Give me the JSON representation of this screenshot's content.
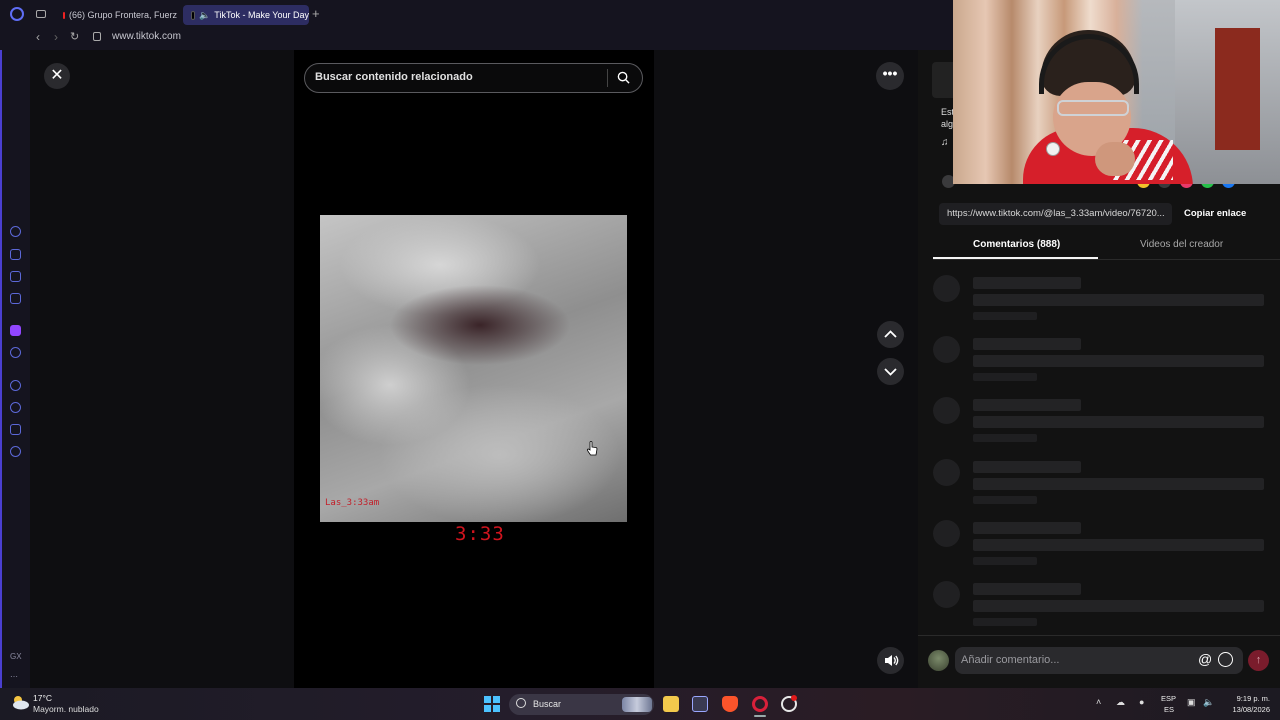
{
  "browser": {
    "tabs": [
      {
        "label": "(66) Grupo Frontera, Fuerz",
        "icon": "youtube-icon"
      },
      {
        "label": "TikTok - Make Your Day",
        "icon": "tiktok-icon",
        "active": true
      }
    ],
    "new_tab_glyph": "+",
    "url": "www.tiktok.com",
    "accent": "#5f6ef5"
  },
  "sidebar": {
    "bottom_label": "GX",
    "more_glyph": "⋯"
  },
  "viewer": {
    "close_glyph": "✕",
    "search_placeholder": "Buscar contenido relacionado",
    "more_glyph": "•••",
    "video_watermark": "Las_3:33am",
    "video_timestamp": "3:33",
    "timestamp_color": "#d0141e"
  },
  "panel": {
    "description_stub_1": "Est",
    "description_stub_2": "alg",
    "music_glyph": "♫",
    "link_url": "https://www.tiktok.com/@las_3.33am/video/76720...",
    "copy_link_label": "Copiar enlace",
    "tabs": [
      {
        "label": "Comentarios (888)",
        "active": true
      },
      {
        "label": "Videos del creador",
        "active": false
      }
    ],
    "comment_placeholder": "Añadir comentario...",
    "at_glyph": "@",
    "send_glyph": "↑",
    "send_color": "#7a1c2c"
  },
  "taskbar": {
    "weather_temp": "17°C",
    "weather_condition": "Mayorm. nublado",
    "search_label": "Buscar",
    "tray_chevron": "˄",
    "lang_line1": "ESP",
    "lang_line2": "ES",
    "time": "9:19 p. m.",
    "date": "13/08/2026"
  }
}
